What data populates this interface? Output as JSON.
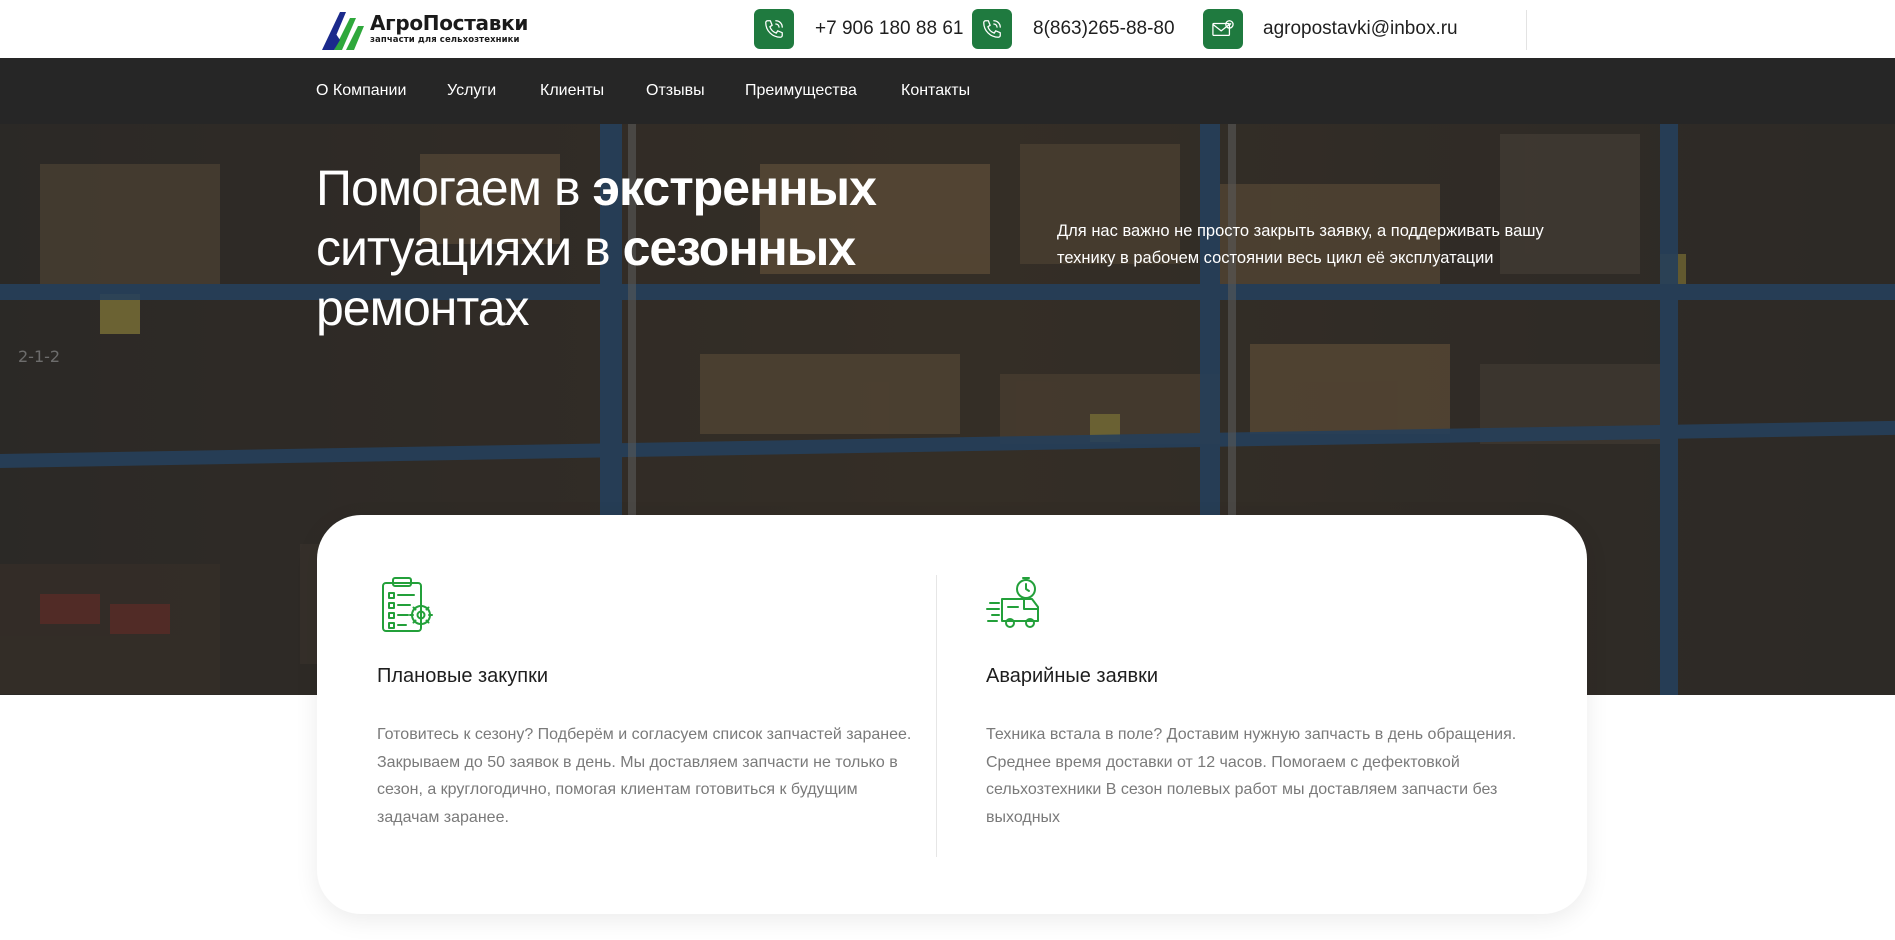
{
  "header": {
    "logo": {
      "name": "АгроПоставки",
      "tagline": "запчасти для сельхозтехники",
      "colors": {
        "green": "#2fa83c",
        "navy": "#1b2a8c"
      }
    },
    "contacts": [
      {
        "icon": "phone-icon",
        "text": "+7 906 180 88 61"
      },
      {
        "icon": "phone-icon",
        "text": "8(863)265-88-80"
      },
      {
        "icon": "mail-icon",
        "text": "agropostavki@inbox.ru"
      }
    ],
    "accent_color": "#1f7a3f"
  },
  "nav": {
    "items": [
      "О Компании",
      "Услуги",
      "Клиенты",
      "Отзывы",
      "Преимущества",
      "Контакты"
    ]
  },
  "hero": {
    "title": {
      "part1": "Помогаем в ",
      "bold1": "экстренных",
      "part2": "ситуацияхи в ",
      "bold2": "сезонных",
      "part3": "ремонтах"
    },
    "subtitle": "Для нас важно не просто закрыть заявку, а поддерживать вашу технику в рабочем состоянии весь цикл её эксплуатации",
    "background": "warehouse-shelves-photo"
  },
  "services": [
    {
      "icon": "clipboard-checklist-icon",
      "title": "Плановые закупки",
      "text": "Готовитесь к сезону? Подберём и согласуем список запчастей заранее. Закрываем до 50 заявок в день. Мы доставляем запчасти не только в сезон, а круглогодично, помогая клиентам готовиться к будущим задачам заранее."
    },
    {
      "icon": "fast-delivery-truck-icon",
      "title": "Аварийные заявки",
      "text": "Техника встала в поле? Доставим нужную запчасть в день обращения. Среднее время доставки от 12 часов. Помогаем с дефектовкой сельхозтехники В сезон полевых работ мы доставляем запчасти без выходных"
    }
  ]
}
